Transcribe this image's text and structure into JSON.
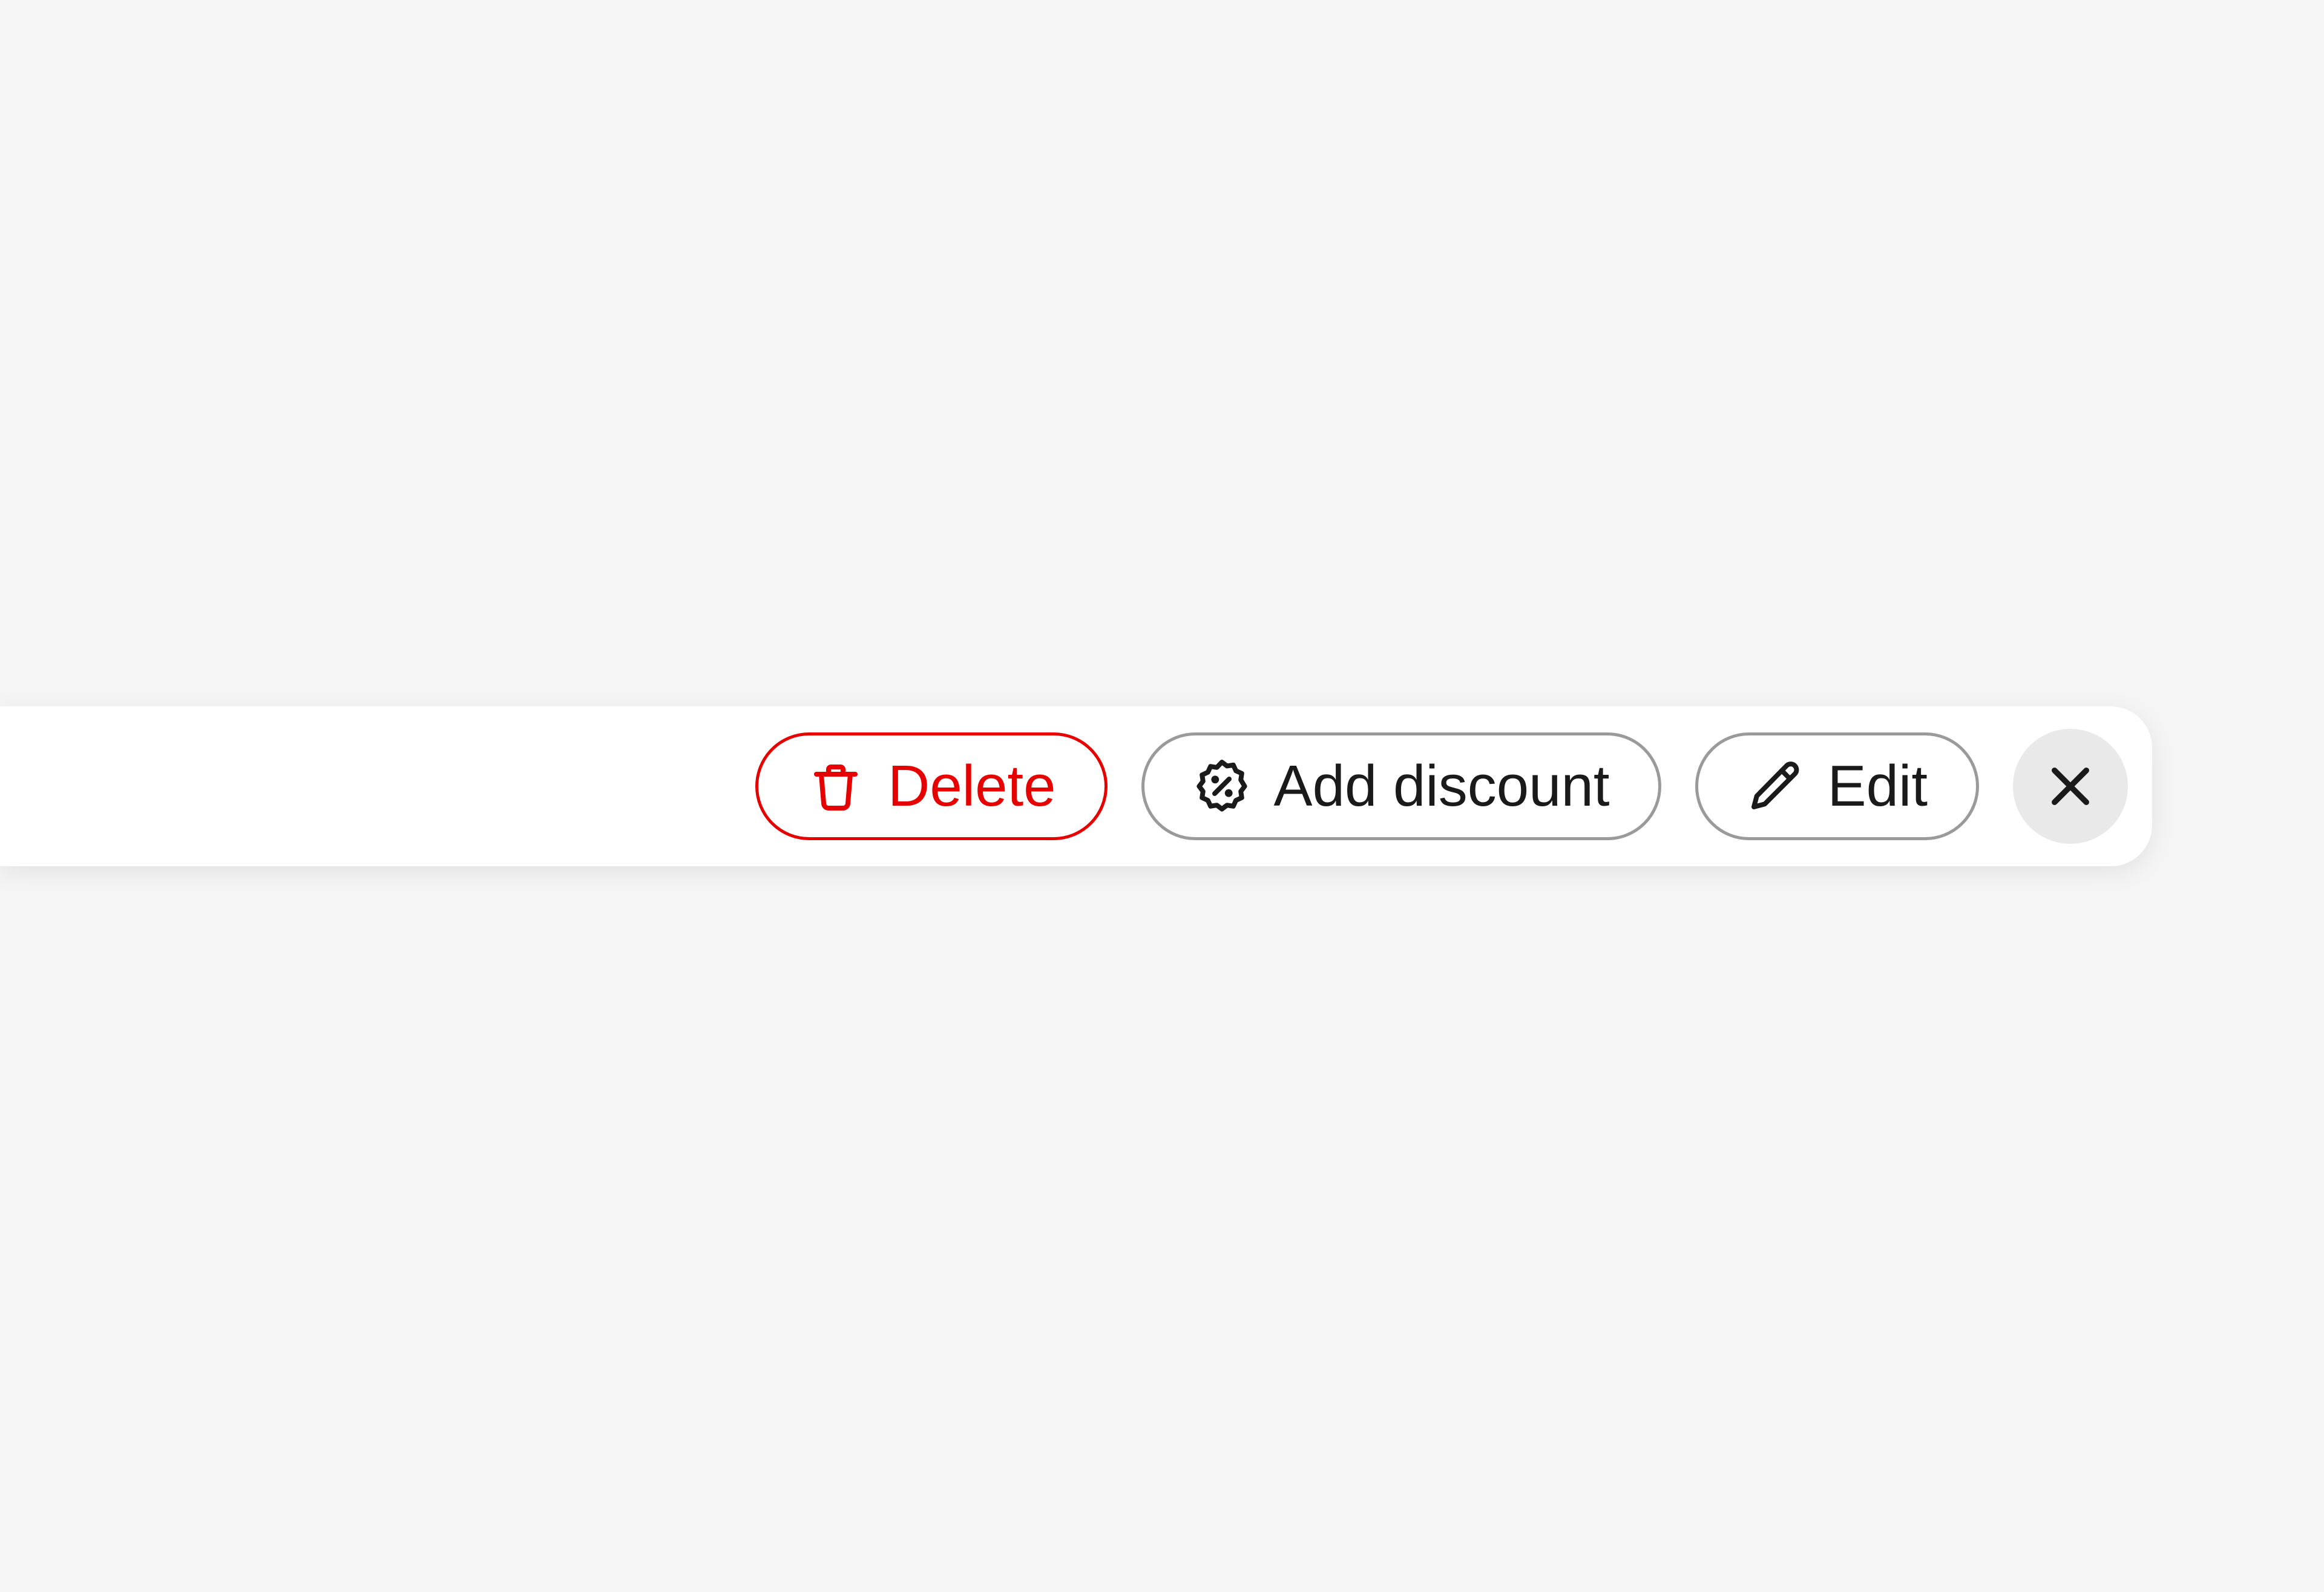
{
  "toolbar": {
    "delete_label": "Delete",
    "add_discount_label": "Add discount",
    "edit_label": "Edit"
  }
}
